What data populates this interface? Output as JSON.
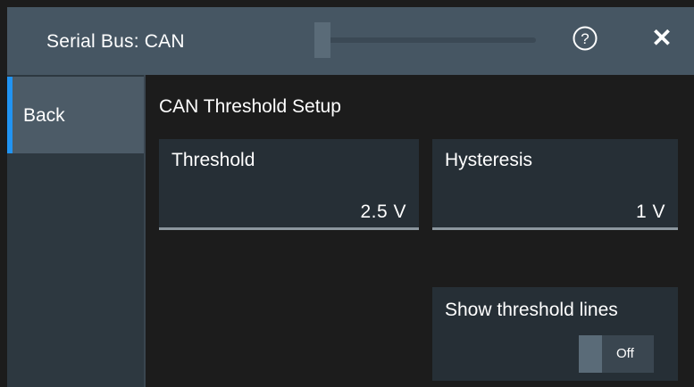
{
  "title": "Serial Bus: CAN",
  "header_icons": {
    "help": "help-icon",
    "close": "close-icon"
  },
  "sidebar": {
    "back_label": "Back"
  },
  "section": {
    "title": "CAN Threshold Setup"
  },
  "threshold": {
    "label": "Threshold",
    "value": "2.5 V"
  },
  "hysteresis": {
    "label": "Hysteresis",
    "value": "1 V"
  },
  "show_lines": {
    "label": "Show threshold lines",
    "state": "Off"
  },
  "colors": {
    "accent": "#2194f3",
    "titlebar": "#465663"
  }
}
